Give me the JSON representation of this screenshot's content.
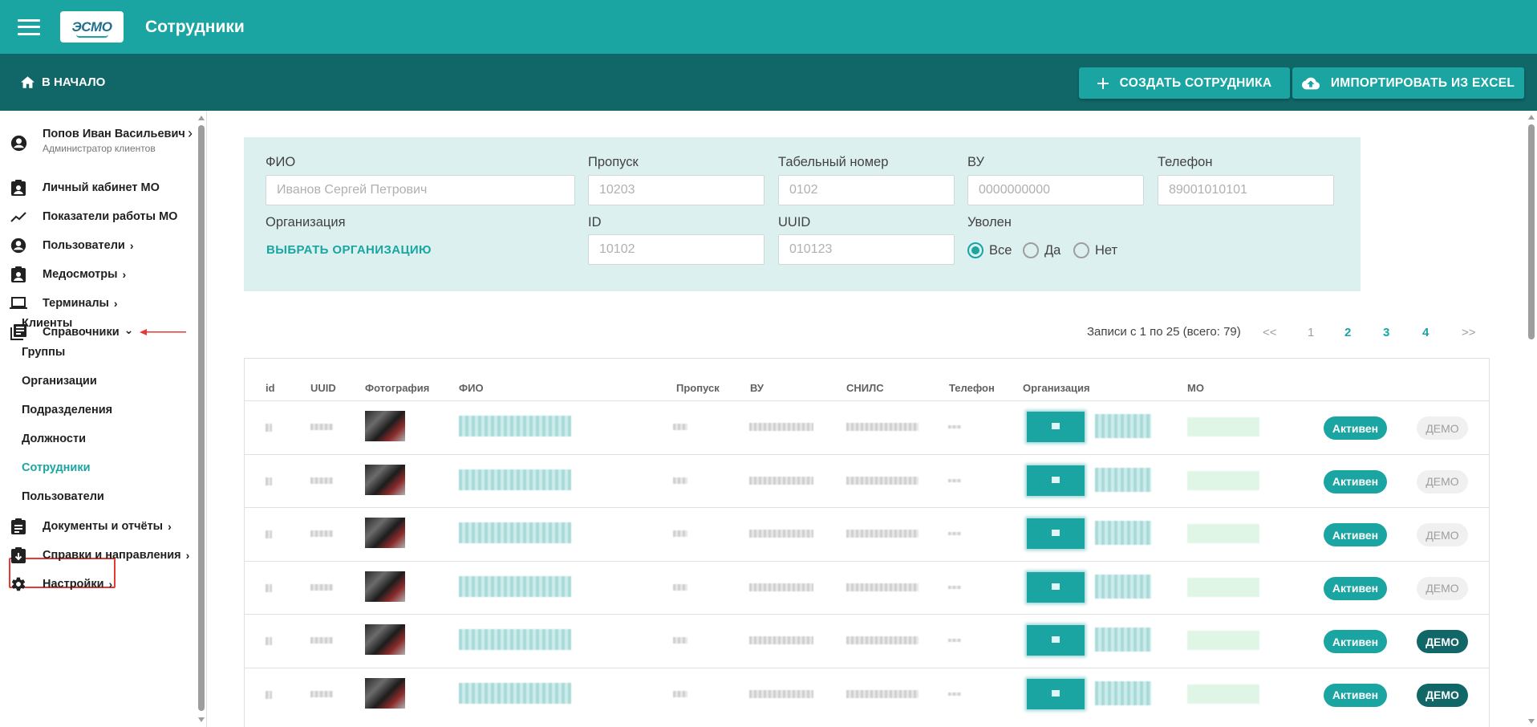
{
  "appbar": {
    "logo_text": "ЭСМО",
    "title": "Сотрудники"
  },
  "subbar": {
    "home_label": "В НАЧАЛО",
    "create_label": "СОЗДАТЬ СОТРУДНИКА",
    "import_label": "ИМПОРТИРОВАТЬ ИЗ EXCEL"
  },
  "sidebar": {
    "user_name": "Попов Иван Васильевич",
    "user_role": "Администратор клиентов",
    "items": [
      {
        "label": "Личный кабинет МО",
        "icon": "clipboard-account-icon"
      },
      {
        "label": "Показатели работы МО",
        "icon": "trending-up-icon"
      },
      {
        "label": "Пользователи",
        "icon": "account-circle-icon",
        "chevron": "›"
      },
      {
        "label": "Медосмотры",
        "icon": "clipboard-account-icon",
        "chevron": "›"
      },
      {
        "label": "Терминалы",
        "icon": "laptop-icon",
        "chevron": "›"
      },
      {
        "label": "Справочники",
        "icon": "book-icon",
        "chevron": "⌄"
      },
      {
        "label": "Документы и отчёты",
        "icon": "clipboard-text-icon",
        "chevron": "›"
      },
      {
        "label": "Справки и направления",
        "icon": "clipboard-arrow-icon",
        "chevron": "›"
      },
      {
        "label": "Настройки",
        "icon": "gear-icon",
        "chevron": "›"
      }
    ],
    "sub_items": [
      "Клиенты",
      "Группы",
      "Организации",
      "Подразделения",
      "Должности",
      "Сотрудники",
      "Пользователи"
    ],
    "active_sub_item": "Сотрудники"
  },
  "filters": {
    "fio_label": "ФИО",
    "fio_placeholder": "Иванов Сергей Петрович",
    "pass_label": "Пропуск",
    "pass_placeholder": "10203",
    "tab_label": "Табельный номер",
    "tab_placeholder": "0102",
    "vu_label": "ВУ",
    "vu_placeholder": "0000000000",
    "phone_label": "Телефон",
    "phone_placeholder": "89001010101",
    "org_label": "Организация",
    "org_link": "ВЫБРАТЬ ОРГАНИЗАЦИЮ",
    "id_label": "ID",
    "id_placeholder": "10102",
    "uuid_label": "UUID",
    "uuid_placeholder": "010123",
    "fired_label": "Уволен",
    "fired_options": [
      "Все",
      "Да",
      "Нет"
    ],
    "fired_selected": "Все"
  },
  "pagination": {
    "summary": "Записи с 1 по 25 (всего: 79)",
    "first": "<<",
    "pages": [
      "1",
      "2",
      "3",
      "4"
    ],
    "current": "1",
    "last": ">>"
  },
  "table": {
    "columns": [
      "id",
      "UUID",
      "Фотография",
      "ФИО",
      "Пропуск",
      "ВУ",
      "СНИЛС",
      "Телефон",
      "Организация",
      "МО"
    ],
    "rows": [
      {
        "status": "Активен",
        "demo": "ДЕМО",
        "demo_active": false
      },
      {
        "status": "Активен",
        "demo": "ДЕМО",
        "demo_active": false
      },
      {
        "status": "Активен",
        "demo": "ДЕМО",
        "demo_active": false
      },
      {
        "status": "Активен",
        "demo": "ДЕМО",
        "demo_active": false
      },
      {
        "status": "Активен",
        "demo": "ДЕМО",
        "demo_active": true
      },
      {
        "status": "Активен",
        "demo": "ДЕМО",
        "demo_active": true
      }
    ]
  },
  "colors": {
    "primary": "#1aa5a2",
    "dark": "#116668",
    "filter_bg": "#dcf0ef",
    "highlight": "#e53935"
  }
}
